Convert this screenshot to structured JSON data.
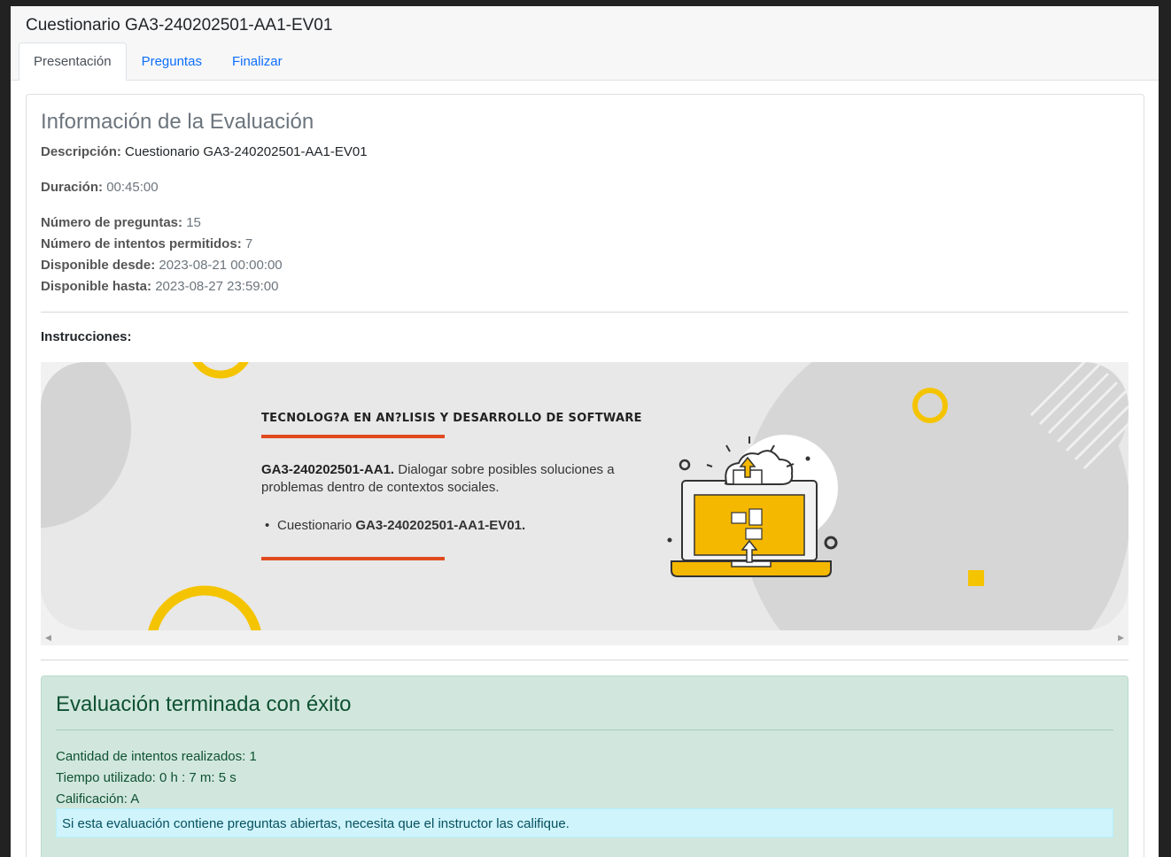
{
  "app": {
    "title": "Cuestionario GA3-240202501-AA1-EV01"
  },
  "tabs": [
    {
      "label": "Presentación",
      "active": true
    },
    {
      "label": "Preguntas",
      "active": false
    },
    {
      "label": "Finalizar",
      "active": false
    }
  ],
  "info": {
    "title": "Información de la Evaluación",
    "descripcion_label": "Descripción:",
    "descripcion_value": "Cuestionario GA3-240202501-AA1-EV01",
    "duracion_label": "Duración:",
    "duracion_value": "00:45:00",
    "preguntas_label": "Número de preguntas:",
    "preguntas_value": "15",
    "intentos_label": "Número de intentos permitidos:",
    "intentos_value": "7",
    "desde_label": "Disponible desde:",
    "desde_value": "2023-08-21 00:00:00",
    "hasta_label": "Disponible hasta:",
    "hasta_value": "2023-08-27 23:59:00"
  },
  "instructions": {
    "label": "Instrucciones:",
    "banner_title": "TECNOLOG?A EN AN?LISIS Y DESARROLLO DE SOFTWARE",
    "activity_code": "GA3-240202501-AA1.",
    "activity_text": " Dialogar sobre posibles soluciones a problemas dentro de contextos sociales.",
    "bullet_prefix": "Cuestionario ",
    "bullet_code": "GA3-240202501-AA1-EV01."
  },
  "result": {
    "title": "Evaluación terminada con éxito",
    "attempts": "Cantidad de intentos realizados: 1",
    "time": "Tiempo utilizado: 0 h : 7 m: 5 s",
    "grade": "Calificación: A",
    "notice": "Si esta evaluación contiene preguntas abiertas, necesita que el instructor las califique."
  },
  "colors": {
    "accent_red": "#e14a1e",
    "accent_yellow": "#f5b800",
    "success_bg": "#d1e7dd",
    "info_bg": "#cff4fc",
    "link": "#0d6efd"
  },
  "icons": [
    "cloud-upload-laptop-illustration"
  ]
}
